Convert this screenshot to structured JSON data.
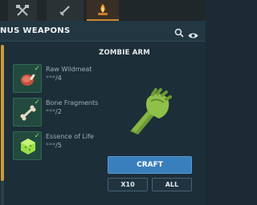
{
  "tabs": [
    {
      "icon": "crossed-axes-icon",
      "active": false
    },
    {
      "icon": "sword-icon",
      "active": false
    },
    {
      "icon": "campfire-icon",
      "active": true
    }
  ],
  "header": {
    "title": "NUS WEAPONS",
    "icons": [
      "search-icon",
      "eye-icon"
    ]
  },
  "item": {
    "title": "ZOMBIE ARM",
    "preview_icon": "zombie-arm-icon"
  },
  "ingredients": [
    {
      "name": "Raw Wildmeat",
      "stars": "***",
      "qty": "/4",
      "icon": "raw-meat-icon",
      "available": true
    },
    {
      "name": "Bone Fragments",
      "stars": "***",
      "qty": "/2",
      "icon": "bone-icon",
      "available": true
    },
    {
      "name": "Essence of Life",
      "stars": "***",
      "qty": "/5",
      "icon": "essence-cube-icon",
      "available": true
    }
  ],
  "buttons": {
    "craft": "CRAFT",
    "x10": "X10",
    "all": "ALL"
  },
  "colors": {
    "accent": "#c89b3c",
    "craft": "#3a7fbd",
    "check": "#7fe07f",
    "slot": "#234a3e"
  }
}
